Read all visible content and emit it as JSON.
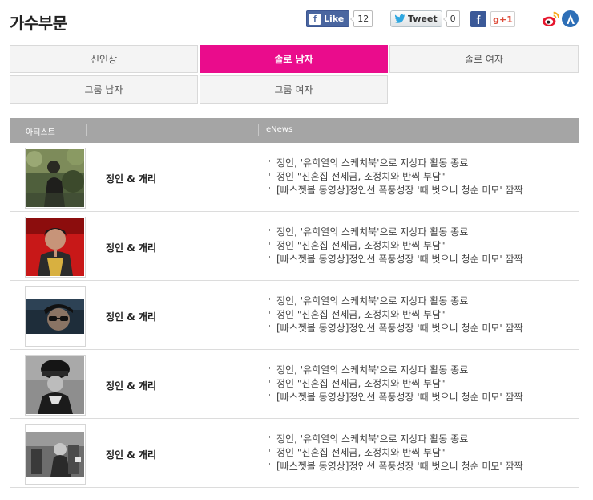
{
  "header": {
    "title": "가수부문",
    "fb_like_label": "Like",
    "fb_like_count": "12",
    "tweet_label": "Tweet",
    "tweet_count": "0",
    "gplus_label": "g+1",
    "fb_square_label": "f"
  },
  "tabs": [
    {
      "label": "신인상",
      "active": false
    },
    {
      "label": "솔로 남자",
      "active": true
    },
    {
      "label": "솔로 여자",
      "active": false
    },
    {
      "label": "그룹 남자",
      "active": false
    },
    {
      "label": "그룹 여자",
      "active": false
    }
  ],
  "table": {
    "col_artist": "아티스트",
    "col_news": "eNews"
  },
  "rows": [
    {
      "name": "정인 & 개리",
      "news": [
        "정인, '유희열의 스케치북'으로 지상파 활동 종료",
        "정인 \"신혼집 전세금, 조정치와 반씩 부담\"",
        "[빠스껫볼 동영상]정인선 폭풍성장 '때 벗으니 청순 미모' 깜짝"
      ]
    },
    {
      "name": "정인 & 개리",
      "news": [
        "정인, '유희열의 스케치북'으로 지상파 활동 종료",
        "정인 \"신혼집 전세금, 조정치와 반씩 부담\"",
        "[빠스껫볼 동영상]정인선 폭풍성장 '때 벗으니 청순 미모' 깜짝"
      ]
    },
    {
      "name": "정인 & 개리",
      "news": [
        "정인, '유희열의 스케치북'으로 지상파 활동 종료",
        "정인 \"신혼집 전세금, 조정치와 반씩 부담\"",
        "[빠스껫볼 동영상]정인선 폭풍성장 '때 벗으니 청순 미모' 깜짝"
      ]
    },
    {
      "name": "정인 & 개리",
      "news": [
        "정인, '유희열의 스케치북'으로 지상파 활동 종료",
        "정인 \"신혼집 전세금, 조정치와 반씩 부담\"",
        "[빠스껫볼 동영상]정인선 폭풍성장 '때 벗으니 청순 미모' 깜짝"
      ]
    },
    {
      "name": "정인 & 개리",
      "news": [
        "정인, '유희열의 스케치북'으로 지상파 활동 종료",
        "정인 \"신혼집 전세금, 조정치와 반씩 부담\"",
        "[빠스껫볼 동영상]정인선 폭풍성장 '때 벗으니 청순 미모' 깜짝"
      ]
    }
  ],
  "colors": {
    "accent": "#ea0c8c",
    "table_header": "#a5a5a5",
    "facebook": "#3b5998",
    "gplus": "#dd4b39"
  },
  "icons": [
    "facebook-like-icon",
    "twitter-bird-icon",
    "facebook-icon",
    "google-plus-icon",
    "weibo-icon",
    "kakao-story-icon"
  ]
}
